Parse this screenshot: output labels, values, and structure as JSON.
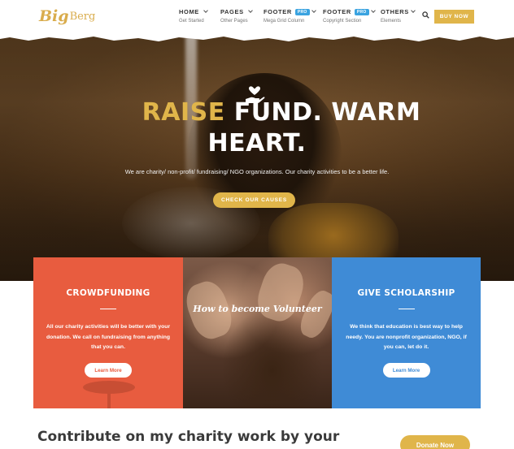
{
  "logo": {
    "mark": "Big",
    "word": "Berg"
  },
  "nav": [
    {
      "label": "HOME",
      "sub": "Get Started",
      "chevron": true,
      "pro": false
    },
    {
      "label": "PAGES",
      "sub": "Other Pages",
      "chevron": true,
      "pro": false
    },
    {
      "label": "FOOTER",
      "sub": "Mega Grid Column",
      "chevron": true,
      "pro": true
    },
    {
      "label": "FOOTER",
      "sub": "Copyright Section",
      "chevron": true,
      "pro": true
    },
    {
      "label": "OTHERS",
      "sub": "Elements",
      "chevron": true,
      "pro": false
    }
  ],
  "pro_badge": "PRO",
  "buy_label": "BUY NOW",
  "hero": {
    "title_gold": "RAISE",
    "title_rest_1": " FUND. WARM",
    "title_line_2": "HEART.",
    "subtitle": "We are charity/ non-profit/ fundraising/ NGO organizations. Our charity activities to be a better life.",
    "button": "CHECK OUR CAUSES"
  },
  "cards": {
    "crowdfunding": {
      "title": "CROWDFUNDING",
      "text": "All our charity activities will be better with your donation. We call on fundraising from anything that you can.",
      "button": "Learn More"
    },
    "volunteer": {
      "title": "How to become Volunteer"
    },
    "scholarship": {
      "title": "GIVE SCHOLARSHIP",
      "text": "We think that education is best way to help needy. You are nonprofit organization, NGO, if you can, let do it.",
      "button": "Learn More"
    }
  },
  "contribute_heading": "Contribute on my charity work by your",
  "donate_button": "Donate Now",
  "colors": {
    "accent_gold": "#e0b54a",
    "card_red": "#e85c3f",
    "card_blue": "#3f8bd6",
    "pro_blue": "#3aa3e0"
  },
  "icons": [
    "search-icon",
    "chevron-down-icon",
    "heart-hand-icon"
  ]
}
